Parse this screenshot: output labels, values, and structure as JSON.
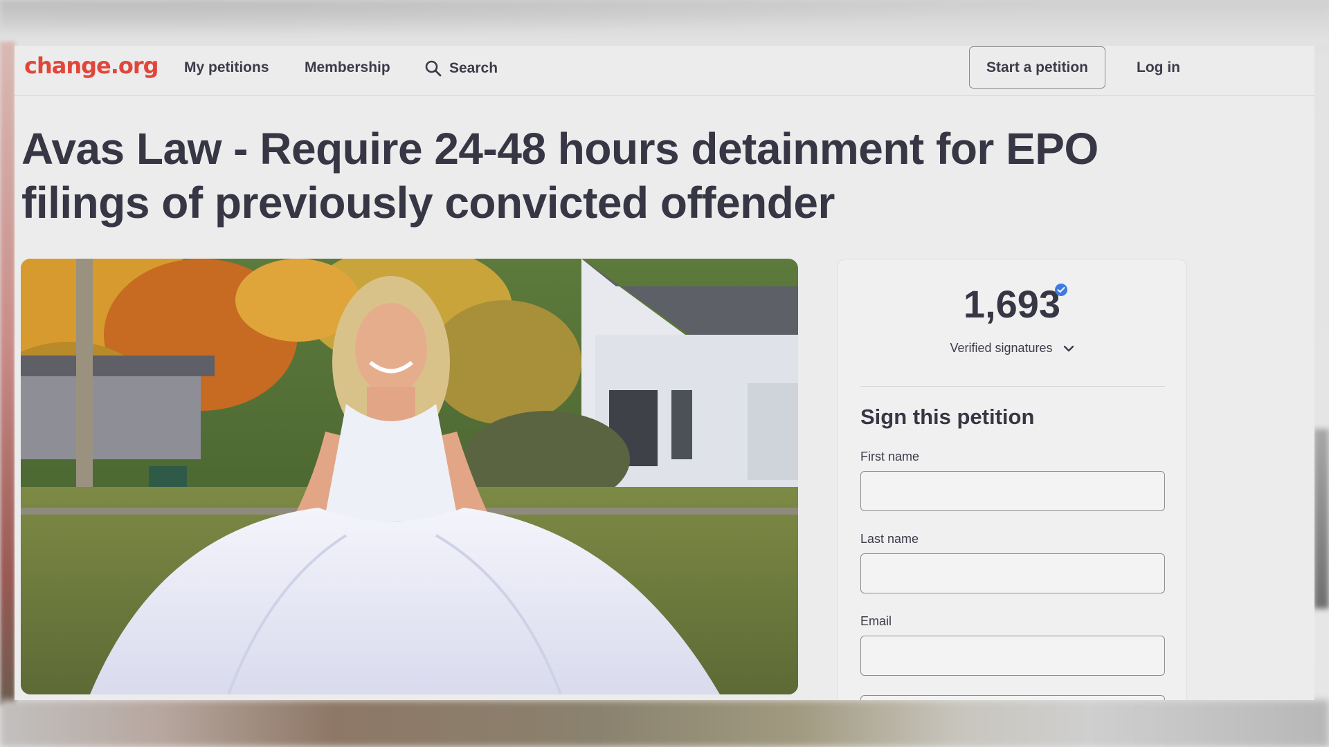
{
  "header": {
    "logo": "change.org",
    "nav": {
      "my_petitions": "My petitions",
      "membership": "Membership",
      "search": "Search"
    },
    "start_petition": "Start a petition",
    "login": "Log in"
  },
  "petition": {
    "title": "Avas Law - Require 24-48 hours detainment for EPO filings of previously convicted offender"
  },
  "signatures": {
    "count": "1,693",
    "label": "Verified signatures"
  },
  "form": {
    "heading": "Sign this petition",
    "first_name_label": "First name",
    "last_name_label": "Last name",
    "email_label": "Email"
  },
  "colors": {
    "brand": "#e0463a",
    "text": "#363645",
    "verified": "#3d7be0"
  },
  "icons": [
    "search-icon",
    "verified-badge-icon",
    "chevron-down-icon"
  ]
}
